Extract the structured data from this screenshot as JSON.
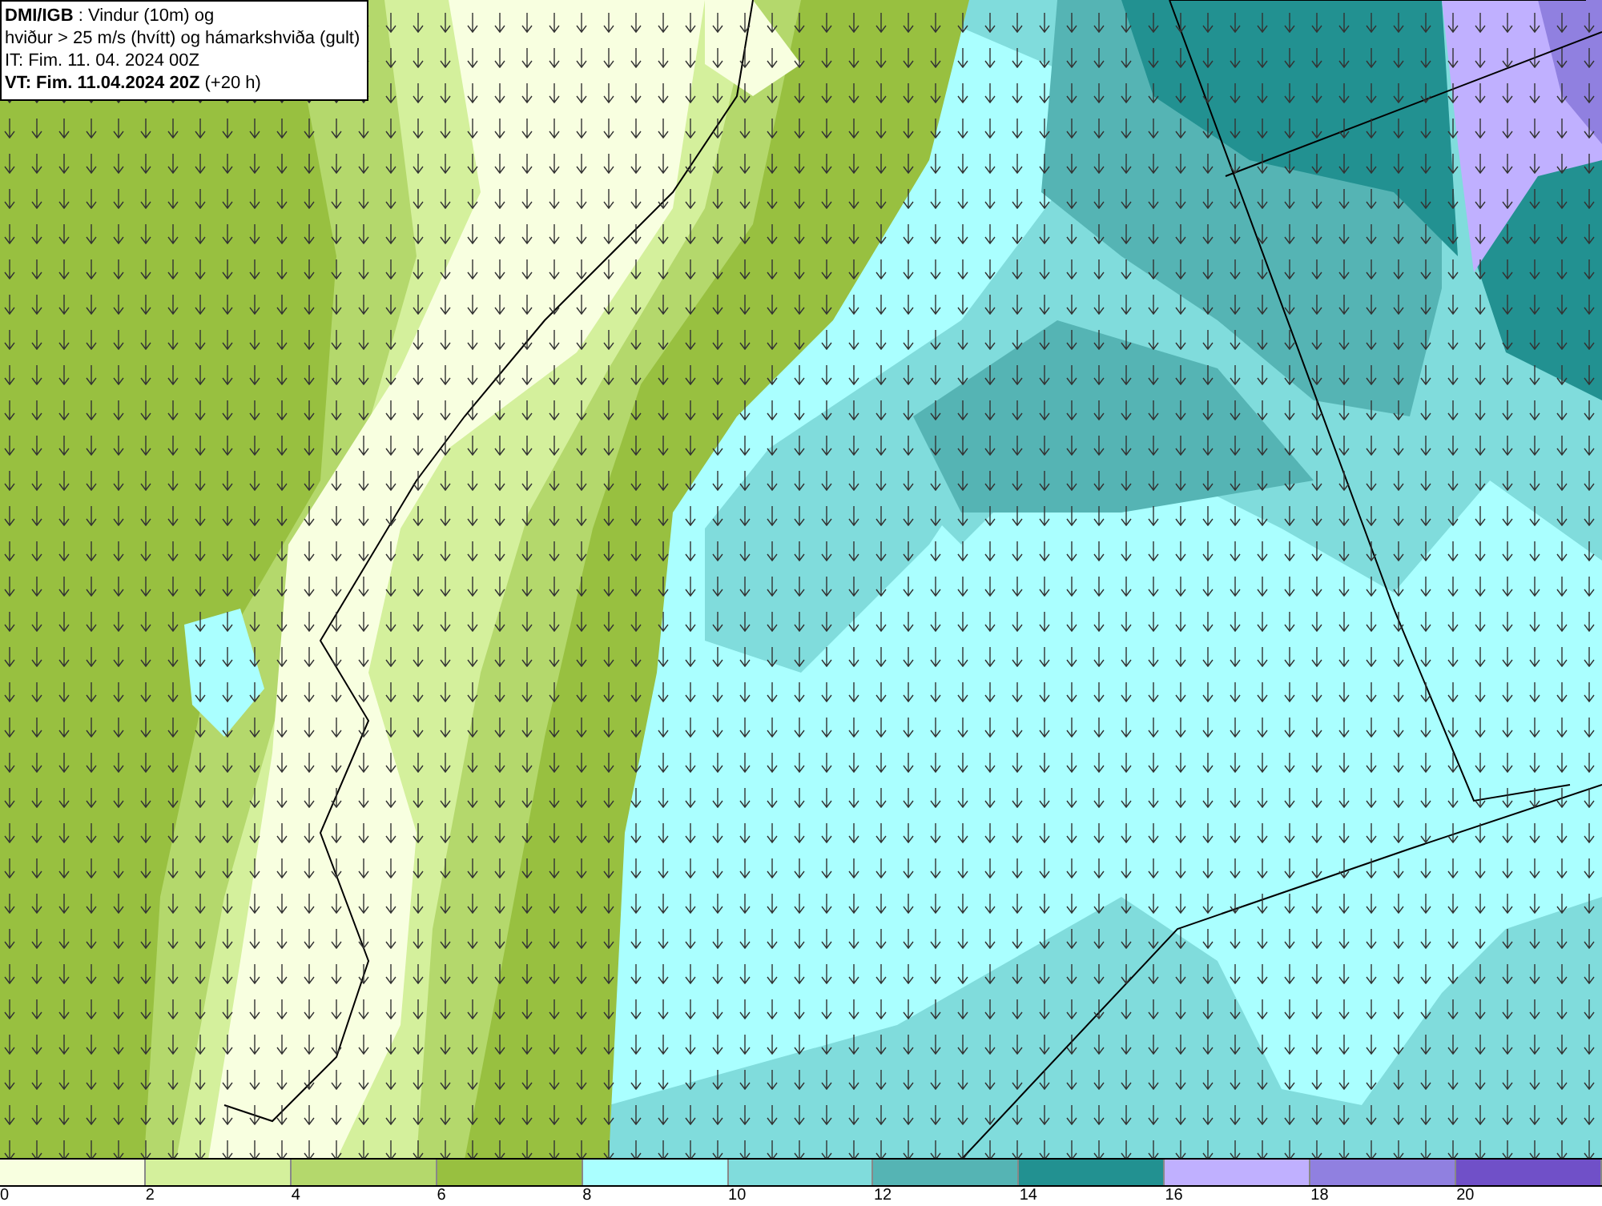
{
  "title_box": {
    "lines": [
      "**DMI/IGB** : Vindur (10m) og",
      "hviður > 25 m/s (hvítt) og hámarkshviða (gult)",
      "IT: Fim. 11. 04. 2024 00Z",
      "**VT: Fim. 11.04.2024 20Z** (+20 h)"
    ]
  },
  "legend": [
    {
      "color": "#f8ffe0",
      "label": "0"
    },
    {
      "color": "#d4f09c",
      "label": "2"
    },
    {
      "color": "#b4d86c",
      "label": "4"
    },
    {
      "color": "#98c040",
      "label": "6"
    },
    {
      "color": "#aaffff",
      "label": "8"
    },
    {
      "color": "#80dcdc",
      "label": "10"
    },
    {
      "color": "#55b4b4",
      "label": "12"
    },
    {
      "color": "#229191",
      "label": "14"
    },
    {
      "color": "#c0b0ff",
      "label": "16"
    },
    {
      "color": "#9080e0",
      "label": "18"
    },
    {
      "color": "#7050c8",
      "label": "20"
    }
  ]
}
